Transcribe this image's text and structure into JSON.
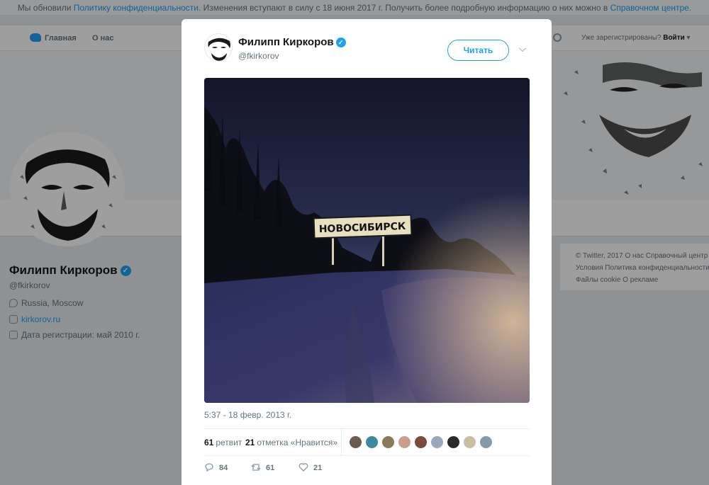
{
  "notice": {
    "text1": "Мы обновили ",
    "link1": "Политику конфиденциальности",
    "text2": ". Изменения вступают в силу с 18 июня 2017 г. Получить более подробную информацию о них можно в ",
    "link2": "Справочном центре",
    "text3": "."
  },
  "nav": {
    "home": "Главная",
    "about": "О нас",
    "login_prompt": "Уже зарегистрированы?",
    "login": "Войти"
  },
  "profile": {
    "name": "Филипп Киркоров",
    "handle": "@fkirkorov",
    "location": "Russia, Moscow",
    "website": "kirkorov.ru",
    "joined": "Дата регистрации: май 2010 г."
  },
  "footer": {
    "line1": "© Twitter, 2017   О нас   Справочный центр",
    "line2": "Условия   Политика конфиденциальности",
    "line3": "Файлы cookie   О рекламе"
  },
  "tweet": {
    "author_name": "Филипп Киркоров",
    "author_handle": "@fkirkorov",
    "follow_label": "Читать",
    "photo_sign": "НОВОСИБИРСК",
    "timestamp": "5:37 - 18 февр. 2013 г.",
    "retweets_count": "61",
    "retweets_label": "ретвит",
    "likes_count": "21",
    "likes_label": "отметка «Нравится»",
    "reply_count": "84",
    "retweet_action_count": "61",
    "like_action_count": "21"
  },
  "likers_colors": [
    "#6b5a4e",
    "#3d8a9e",
    "#8a7a5a",
    "#c9a090",
    "#7a4a3a",
    "#9aaabb",
    "#2a2a2a",
    "#c8c0a0",
    "#8899aa"
  ],
  "colors": {
    "accent": "#1da1f2",
    "text_secondary": "#66757f"
  }
}
